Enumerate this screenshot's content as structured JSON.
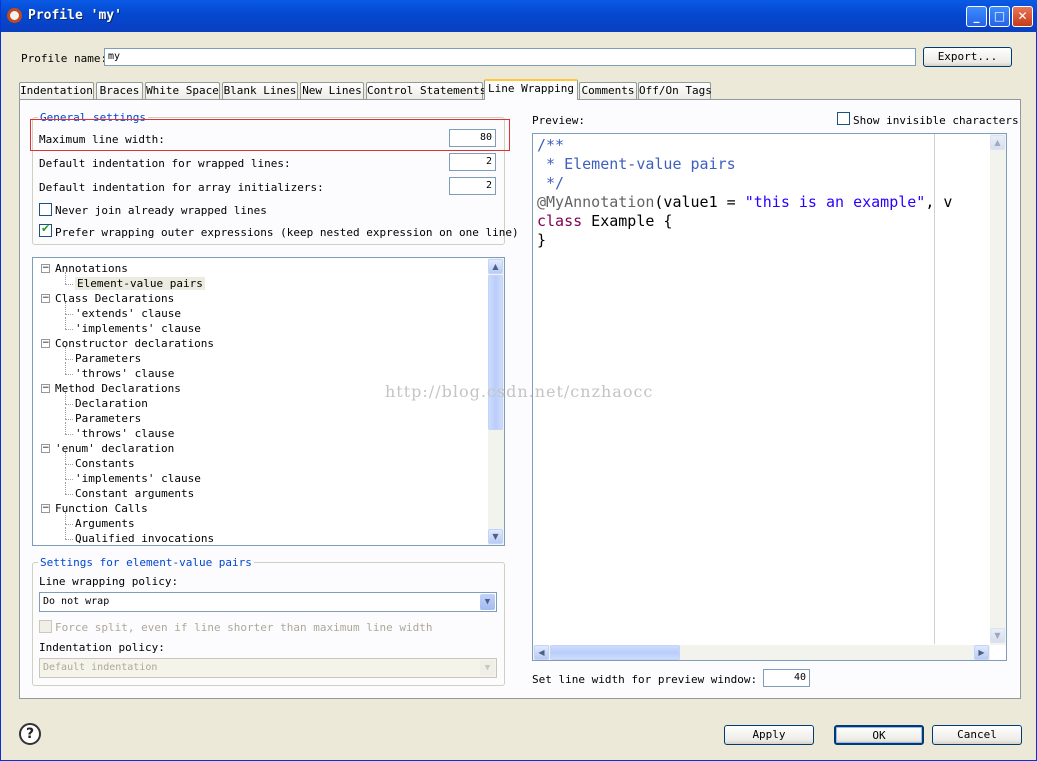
{
  "window": {
    "title": "Profile 'my'",
    "minimize": "_",
    "maximize": "□",
    "close": "✕"
  },
  "profile": {
    "label": "Profile name:",
    "value": "my",
    "export_label": "Export..."
  },
  "tabs": [
    {
      "label": "Indentation"
    },
    {
      "label": "Braces"
    },
    {
      "label": "White Space"
    },
    {
      "label": "Blank Lines"
    },
    {
      "label": "New Lines"
    },
    {
      "label": "Control Statements"
    },
    {
      "label": "Line Wrapping"
    },
    {
      "label": "Comments"
    },
    {
      "label": "Off/On Tags"
    }
  ],
  "general": {
    "title": "General settings",
    "max_width_label": "Maximum line width:",
    "max_width_value": "80",
    "default_indent_label": "Default indentation for wrapped lines:",
    "default_indent_value": "2",
    "array_indent_label": "Default indentation for array initializers:",
    "array_indent_value": "2",
    "never_join_label": "Never join already wrapped lines",
    "never_join_checked": false,
    "prefer_outer_label": "Prefer wrapping outer expressions (keep nested expression on one line)",
    "prefer_outer_checked": true
  },
  "tree": {
    "items": [
      {
        "label": "Annotations",
        "level": 0,
        "expanded": true
      },
      {
        "label": "Element-value pairs",
        "level": 1,
        "selected": true
      },
      {
        "label": "Class Declarations",
        "level": 0,
        "expanded": true
      },
      {
        "label": "'extends' clause",
        "level": 1
      },
      {
        "label": "'implements' clause",
        "level": 1
      },
      {
        "label": "Constructor declarations",
        "level": 0,
        "expanded": true
      },
      {
        "label": "Parameters",
        "level": 1
      },
      {
        "label": "'throws' clause",
        "level": 1
      },
      {
        "label": "Method Declarations",
        "level": 0,
        "expanded": true
      },
      {
        "label": "Declaration",
        "level": 1
      },
      {
        "label": "Parameters",
        "level": 1
      },
      {
        "label": "'throws' clause",
        "level": 1
      },
      {
        "label": "'enum' declaration",
        "level": 0,
        "expanded": true
      },
      {
        "label": "Constants",
        "level": 1
      },
      {
        "label": "'implements' clause",
        "level": 1
      },
      {
        "label": "Constant arguments",
        "level": 1
      },
      {
        "label": "Function Calls",
        "level": 0,
        "expanded": true
      },
      {
        "label": "Arguments",
        "level": 1
      },
      {
        "label": "Qualified invocations",
        "level": 1
      }
    ]
  },
  "element_settings": {
    "title": "Settings for element-value pairs",
    "policy_label": "Line wrapping policy:",
    "policy_value": "Do not wrap",
    "force_split_label": "Force split, even if line shorter than maximum line width",
    "force_split_checked": false,
    "indent_policy_label": "Indentation policy:",
    "indent_policy_value": "Default indentation"
  },
  "preview": {
    "label": "Preview:",
    "show_invisible_label": "Show invisible characters",
    "show_invisible_checked": false,
    "code_lines": [
      "/**",
      " * Element-value pairs",
      " */",
      "@MyAnnotation(value1 = \"this is an example\", v",
      "class Example {",
      "}"
    ],
    "line_width_label": "Set line width for preview window:",
    "line_width_value": "40"
  },
  "watermark": "http://blog.csdn.net/cnzhaocc",
  "footer": {
    "help": "?",
    "apply": "Apply",
    "ok": "OK",
    "cancel": "Cancel"
  },
  "colors": {
    "highlight_box": "#e03030",
    "titlebar": "#0548d0",
    "group_title": "#0046d5"
  }
}
